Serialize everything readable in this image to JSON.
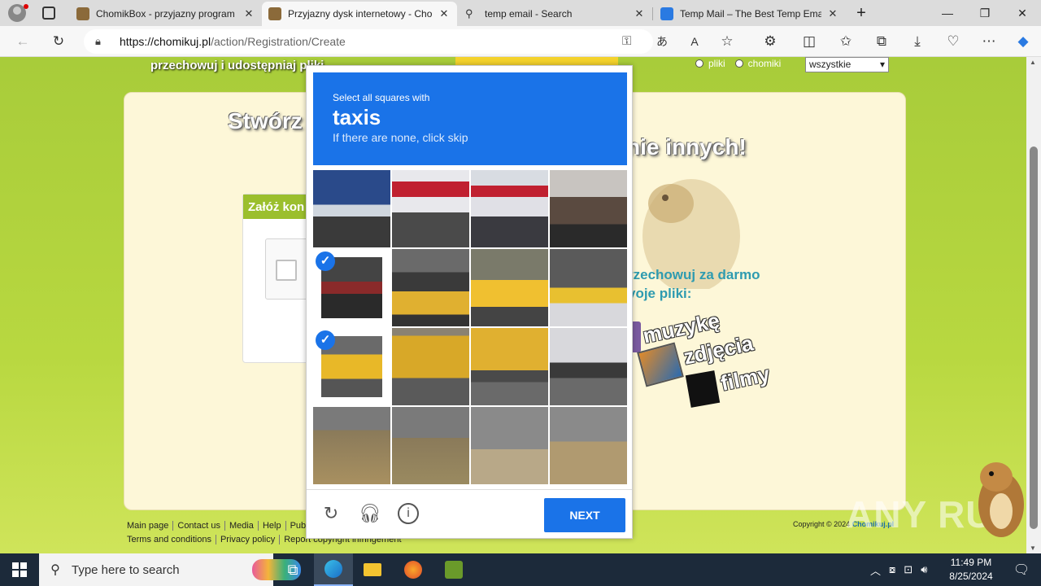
{
  "browser": {
    "tabs": [
      {
        "title": "ChomikBox - przyjazny program",
        "active": false
      },
      {
        "title": "Przyjazny dysk internetowy - Cho",
        "active": true
      },
      {
        "title": "temp email - Search",
        "active": false
      },
      {
        "title": "Temp Mail – The Best Temp Email",
        "active": false
      }
    ],
    "new_tab": "+",
    "url_domain": "https://chomikuj.pl",
    "url_path": "/action/Registration/Create"
  },
  "site": {
    "tagline": "przechowuj i udostępniaj pliki",
    "search_opts": [
      "pliki",
      "chomiki"
    ],
    "search_select": "wszystkie",
    "headline_left": "Stwórz",
    "headline_right": "nie innych!",
    "panel_title": "Załóż kon",
    "promo_line1": "rzechowuj za darmo",
    "promo_line2": "voje pliki:",
    "promo_items": [
      "muzykę",
      "zdjęcia",
      "filmy"
    ],
    "footer_row1": [
      "Main page",
      "Contact us",
      "Media",
      "Help",
      "Publ"
    ],
    "footer_row2": [
      "Terms and conditions",
      "Privacy policy",
      "Report copyright infringement"
    ],
    "copyright_prefix": "Copyright © 2024",
    "copyright_brand": "Chomikuj.pl",
    "watermark": "ANY RUN"
  },
  "captcha": {
    "instruction": "Select all squares with",
    "target": "taxis",
    "hint": "If there are none, click skip",
    "selected_tiles": [
      4,
      8
    ],
    "next_label": "NEXT",
    "icons": [
      "reload-icon",
      "audio-icon",
      "info-icon"
    ]
  },
  "taskbar": {
    "search_placeholder": "Type here to search",
    "time": "11:49 PM",
    "date": "8/25/2024"
  }
}
